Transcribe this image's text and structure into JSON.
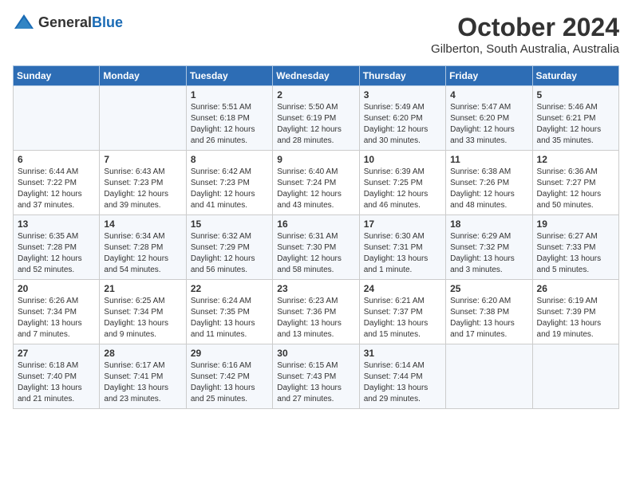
{
  "header": {
    "logo_general": "General",
    "logo_blue": "Blue",
    "month": "October 2024",
    "location": "Gilberton, South Australia, Australia"
  },
  "weekdays": [
    "Sunday",
    "Monday",
    "Tuesday",
    "Wednesday",
    "Thursday",
    "Friday",
    "Saturday"
  ],
  "weeks": [
    [
      {
        "day": "",
        "info": ""
      },
      {
        "day": "",
        "info": ""
      },
      {
        "day": "1",
        "info": "Sunrise: 5:51 AM\nSunset: 6:18 PM\nDaylight: 12 hours\nand 26 minutes."
      },
      {
        "day": "2",
        "info": "Sunrise: 5:50 AM\nSunset: 6:19 PM\nDaylight: 12 hours\nand 28 minutes."
      },
      {
        "day": "3",
        "info": "Sunrise: 5:49 AM\nSunset: 6:20 PM\nDaylight: 12 hours\nand 30 minutes."
      },
      {
        "day": "4",
        "info": "Sunrise: 5:47 AM\nSunset: 6:20 PM\nDaylight: 12 hours\nand 33 minutes."
      },
      {
        "day": "5",
        "info": "Sunrise: 5:46 AM\nSunset: 6:21 PM\nDaylight: 12 hours\nand 35 minutes."
      }
    ],
    [
      {
        "day": "6",
        "info": "Sunrise: 6:44 AM\nSunset: 7:22 PM\nDaylight: 12 hours\nand 37 minutes."
      },
      {
        "day": "7",
        "info": "Sunrise: 6:43 AM\nSunset: 7:23 PM\nDaylight: 12 hours\nand 39 minutes."
      },
      {
        "day": "8",
        "info": "Sunrise: 6:42 AM\nSunset: 7:23 PM\nDaylight: 12 hours\nand 41 minutes."
      },
      {
        "day": "9",
        "info": "Sunrise: 6:40 AM\nSunset: 7:24 PM\nDaylight: 12 hours\nand 43 minutes."
      },
      {
        "day": "10",
        "info": "Sunrise: 6:39 AM\nSunset: 7:25 PM\nDaylight: 12 hours\nand 46 minutes."
      },
      {
        "day": "11",
        "info": "Sunrise: 6:38 AM\nSunset: 7:26 PM\nDaylight: 12 hours\nand 48 minutes."
      },
      {
        "day": "12",
        "info": "Sunrise: 6:36 AM\nSunset: 7:27 PM\nDaylight: 12 hours\nand 50 minutes."
      }
    ],
    [
      {
        "day": "13",
        "info": "Sunrise: 6:35 AM\nSunset: 7:28 PM\nDaylight: 12 hours\nand 52 minutes."
      },
      {
        "day": "14",
        "info": "Sunrise: 6:34 AM\nSunset: 7:28 PM\nDaylight: 12 hours\nand 54 minutes."
      },
      {
        "day": "15",
        "info": "Sunrise: 6:32 AM\nSunset: 7:29 PM\nDaylight: 12 hours\nand 56 minutes."
      },
      {
        "day": "16",
        "info": "Sunrise: 6:31 AM\nSunset: 7:30 PM\nDaylight: 12 hours\nand 58 minutes."
      },
      {
        "day": "17",
        "info": "Sunrise: 6:30 AM\nSunset: 7:31 PM\nDaylight: 13 hours\nand 1 minute."
      },
      {
        "day": "18",
        "info": "Sunrise: 6:29 AM\nSunset: 7:32 PM\nDaylight: 13 hours\nand 3 minutes."
      },
      {
        "day": "19",
        "info": "Sunrise: 6:27 AM\nSunset: 7:33 PM\nDaylight: 13 hours\nand 5 minutes."
      }
    ],
    [
      {
        "day": "20",
        "info": "Sunrise: 6:26 AM\nSunset: 7:34 PM\nDaylight: 13 hours\nand 7 minutes."
      },
      {
        "day": "21",
        "info": "Sunrise: 6:25 AM\nSunset: 7:34 PM\nDaylight: 13 hours\nand 9 minutes."
      },
      {
        "day": "22",
        "info": "Sunrise: 6:24 AM\nSunset: 7:35 PM\nDaylight: 13 hours\nand 11 minutes."
      },
      {
        "day": "23",
        "info": "Sunrise: 6:23 AM\nSunset: 7:36 PM\nDaylight: 13 hours\nand 13 minutes."
      },
      {
        "day": "24",
        "info": "Sunrise: 6:21 AM\nSunset: 7:37 PM\nDaylight: 13 hours\nand 15 minutes."
      },
      {
        "day": "25",
        "info": "Sunrise: 6:20 AM\nSunset: 7:38 PM\nDaylight: 13 hours\nand 17 minutes."
      },
      {
        "day": "26",
        "info": "Sunrise: 6:19 AM\nSunset: 7:39 PM\nDaylight: 13 hours\nand 19 minutes."
      }
    ],
    [
      {
        "day": "27",
        "info": "Sunrise: 6:18 AM\nSunset: 7:40 PM\nDaylight: 13 hours\nand 21 minutes."
      },
      {
        "day": "28",
        "info": "Sunrise: 6:17 AM\nSunset: 7:41 PM\nDaylight: 13 hours\nand 23 minutes."
      },
      {
        "day": "29",
        "info": "Sunrise: 6:16 AM\nSunset: 7:42 PM\nDaylight: 13 hours\nand 25 minutes."
      },
      {
        "day": "30",
        "info": "Sunrise: 6:15 AM\nSunset: 7:43 PM\nDaylight: 13 hours\nand 27 minutes."
      },
      {
        "day": "31",
        "info": "Sunrise: 6:14 AM\nSunset: 7:44 PM\nDaylight: 13 hours\nand 29 minutes."
      },
      {
        "day": "",
        "info": ""
      },
      {
        "day": "",
        "info": ""
      }
    ]
  ]
}
